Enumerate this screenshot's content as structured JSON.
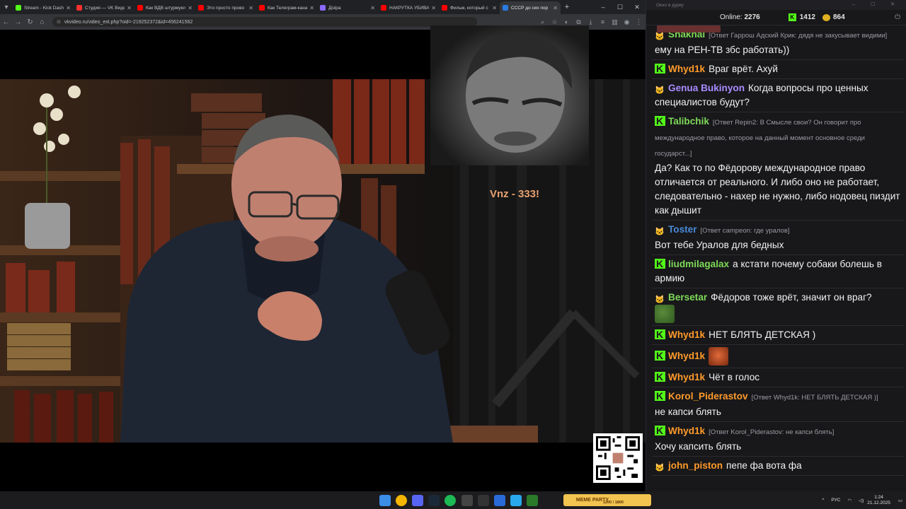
{
  "browser": {
    "tabs": [
      {
        "label": "Stream - Kick Dash",
        "color": "#53fc18",
        "active": false
      },
      {
        "label": "Студия — VK Видео",
        "color": "#ff3030",
        "active": false
      },
      {
        "label": "Как ВДВ штурмуют",
        "color": "#ff0000",
        "active": false
      },
      {
        "label": "Это просто прово",
        "color": "#ff0000",
        "active": false
      },
      {
        "label": "Как Телеграм-кана",
        "color": "#ff0000",
        "active": false
      },
      {
        "label": "Дізіра",
        "color": "#8a6aff",
        "active": false
      },
      {
        "label": "НАКРУТКА УБИВАЕ",
        "color": "#ff0000",
        "active": false
      },
      {
        "label": "Фильм, который с",
        "color": "#ff0000",
        "active": false
      },
      {
        "label": "СССР до сих пор",
        "color": "#2a7ae2",
        "active": true
      }
    ],
    "new_tab": "+",
    "url": "vkvideo.ru/video_ext.php?oid=-219252372&id=456241562"
  },
  "video": {
    "overlay_text": "Vnz  - 333!"
  },
  "chat": {
    "window_title": "Окно в дурку",
    "online_label": "Online:",
    "online_count": "2276",
    "kick_count": "1412",
    "yt_count": "864",
    "messages": [
      {
        "user": "Shakhal",
        "color": "#7ed957",
        "badge": "cat",
        "reply": "[Ответ Гаррош Адский Крик: дядя не закусывает видими]",
        "text": "ему на РЕН-ТВ збс работать))"
      },
      {
        "user": "Whyd1k",
        "color": "#ff9a2a",
        "badge": "kick",
        "reply": "",
        "text": "Враг врёт. Ахуй"
      },
      {
        "user": "Genua Bukinyon",
        "color": "#a98bff",
        "badge": "cat",
        "reply": "",
        "text": "Когда вопросы про ценных специалистов будут?"
      },
      {
        "user": "Talibchik",
        "color": "#7ed957",
        "badge": "kick",
        "reply": "[Ответ Repin2: В Смысле свои? Он говорит про международное право, которое на данный момент основное среди государст...]",
        "text": "Да? Как то по Фёдорову международное право отличается от реального. И либо оно не работает, следовательно - нахер не нужно, либо нодовец пиздит как дышит"
      },
      {
        "user": "Toster",
        "color": "#4a8ad8",
        "badge": "cat",
        "reply": "[Ответ campeon: где уралов]",
        "text": "Вот тебе Уралов для бедных"
      },
      {
        "user": "liudmilagalax",
        "color": "#7ed957",
        "badge": "kick",
        "reply": "",
        "text": "а кстати почему собаки болешь в армию"
      },
      {
        "user": "Bersetar",
        "color": "#7ed957",
        "badge": "cat",
        "reply": "",
        "text": "Фёдоров тоже врёт, значит он враг?",
        "emote": "pepe"
      },
      {
        "user": "Whyd1k",
        "color": "#ff9a2a",
        "badge": "kick",
        "reply": "",
        "text": "НЕТ БЛЯТЬ ДЕТСКАЯ )"
      },
      {
        "user": "Whyd1k",
        "color": "#ff9a2a",
        "badge": "kick",
        "reply": "",
        "text": "",
        "emote": "face"
      },
      {
        "user": "Whyd1k",
        "color": "#ff9a2a",
        "badge": "kick",
        "reply": "",
        "text": "Чёт в голос"
      },
      {
        "user": "Korol_Piderastov",
        "color": "#ff9a2a",
        "badge": "kick",
        "reply": "[Ответ Whyd1k: НЕТ БЛЯТЬ ДЕТСКАЯ )]",
        "text": "не капси блять"
      },
      {
        "user": "Whyd1k",
        "color": "#ff9a2a",
        "badge": "kick",
        "reply": "[Ответ Korol_Piderastov: не капси блять]",
        "text": "Хочу капсить блять"
      },
      {
        "user": "john_piston",
        "color": "#ff9a2a",
        "badge": "cat",
        "reply": "",
        "text": "пепе фа вота фа"
      }
    ]
  },
  "taskbar": {
    "meme_label": "MEME PARTY",
    "meme_sub": "1200 / 1800",
    "lang": "РУС",
    "time": "1:24",
    "date": "21.12.2025"
  }
}
